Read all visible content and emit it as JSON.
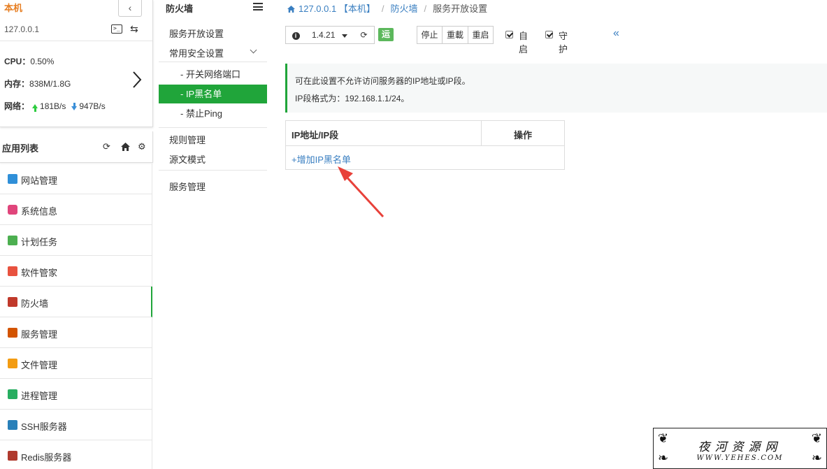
{
  "server": {
    "title": "本机",
    "ip": "127.0.0.1",
    "cpu_label": "CPU：",
    "cpu_value": "0.50%",
    "mem_label": "内存：",
    "mem_value": "838M/1.8G",
    "net_label": "网络：",
    "net_up": "181B/s",
    "net_down": "947B/s",
    "collapse_glyph": "‹",
    "next_glyph": "›"
  },
  "applist": {
    "title": "应用列表",
    "items": [
      {
        "label": "网站管理",
        "color": "#2f8fd8"
      },
      {
        "label": "系统信息",
        "color": "#e0457b"
      },
      {
        "label": "计划任务",
        "color": "#4caf50"
      },
      {
        "label": "软件管家",
        "color": "#e8523f"
      },
      {
        "label": "防火墙",
        "color": "#c0392b"
      },
      {
        "label": "服务管理",
        "color": "#d35400"
      },
      {
        "label": "文件管理",
        "color": "#f39c12"
      },
      {
        "label": "进程管理",
        "color": "#27ae60"
      },
      {
        "label": "SSH服务器",
        "color": "#2980b9"
      },
      {
        "label": "Redis服务器",
        "color": "#b03a2e"
      }
    ]
  },
  "menu": {
    "title": "防火墙",
    "items": {
      "service_open": "服务开放设置",
      "common_security": "常用安全设置",
      "sub_ports": "- 开关网络端口",
      "sub_ip_blacklist": "- IP黑名单",
      "sub_ping": "- 禁止Ping",
      "rules": "规则管理",
      "source_mode": "源文模式",
      "service_manage": "服务管理"
    }
  },
  "breadcrumb": {
    "home": "127.0.0.1 【本机】",
    "section": "防火墙",
    "current": "服务开放设置"
  },
  "toolbar": {
    "info_glyph": "i",
    "version": "1.4.21",
    "status": "运行中",
    "stop": "停止",
    "reload": "重載",
    "restart": "重启",
    "autostart": "自启",
    "guard": "守护",
    "collapse_glyph": "«"
  },
  "notice": {
    "line1": "可在此设置不允许访问服务器的IP地址或IP段。",
    "line2": "IP段格式为：192.168.1.1/24。"
  },
  "table": {
    "col_ip": "IP地址/IP段",
    "col_action": "操作",
    "add_link": "+增加IP黑名单"
  },
  "watermark": {
    "title": "夜河资源网",
    "url": "WWW.YEHES.COM"
  },
  "colors": {
    "accent": "#20a53a",
    "link": "#3a7fc1",
    "server_title": "#e67e22",
    "arrow": "#e8413a"
  }
}
